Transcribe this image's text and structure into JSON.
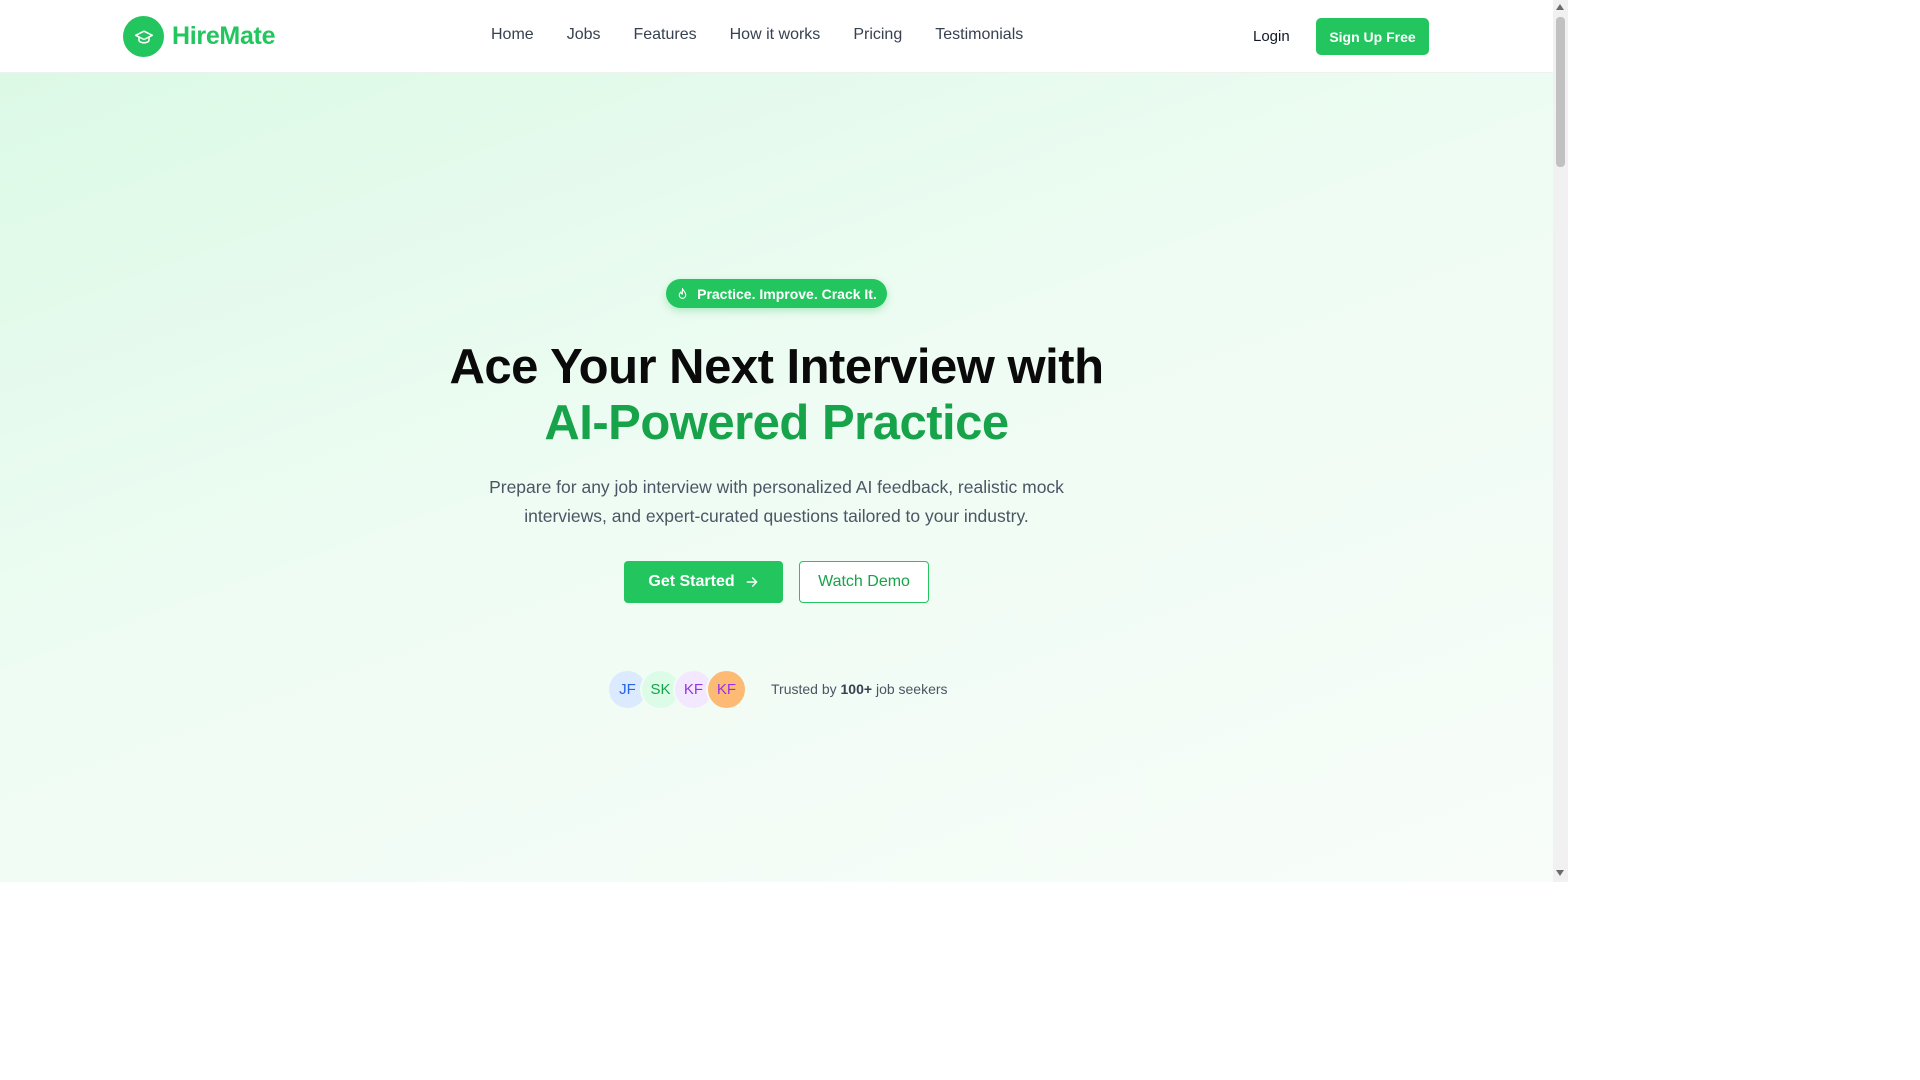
{
  "brand": {
    "name": "HireMate",
    "color": "#22c55e",
    "logo_icon": "graduation-cap-icon"
  },
  "nav": {
    "links": [
      "Home",
      "Jobs",
      "Features",
      "How it works",
      "Pricing",
      "Testimonials"
    ]
  },
  "auth": {
    "login_label": "Login",
    "signup_label": "Sign Up Free"
  },
  "hero": {
    "badge": {
      "icon": "flame-icon",
      "text": "Practice. Improve. Crack It."
    },
    "title_line1": "Ace Your Next Interview with",
    "title_line2": "AI-Powered Practice",
    "title_accent_color": "#16a34a",
    "subtitle": "Prepare for any job interview with personalized AI feedback, realistic mock interviews, and expert-curated questions tailored to your industry.",
    "primary_cta": {
      "label": "Get Started",
      "icon": "arrow-right-icon"
    },
    "secondary_cta": {
      "label": "Watch Demo"
    },
    "avatars": [
      {
        "initials": "JF",
        "bg": "#dbeafe",
        "fg": "#2563eb"
      },
      {
        "initials": "SK",
        "bg": "#dcfce7",
        "fg": "#16a34a"
      },
      {
        "initials": "KF",
        "bg": "#f3e8ff",
        "fg": "#9333ea"
      },
      {
        "initials": "KF",
        "bg": "#fdba74",
        "fg": "#9333ea"
      }
    ],
    "trust": {
      "prefix": "Trusted by",
      "count": "100+",
      "suffix": "job seekers"
    }
  }
}
